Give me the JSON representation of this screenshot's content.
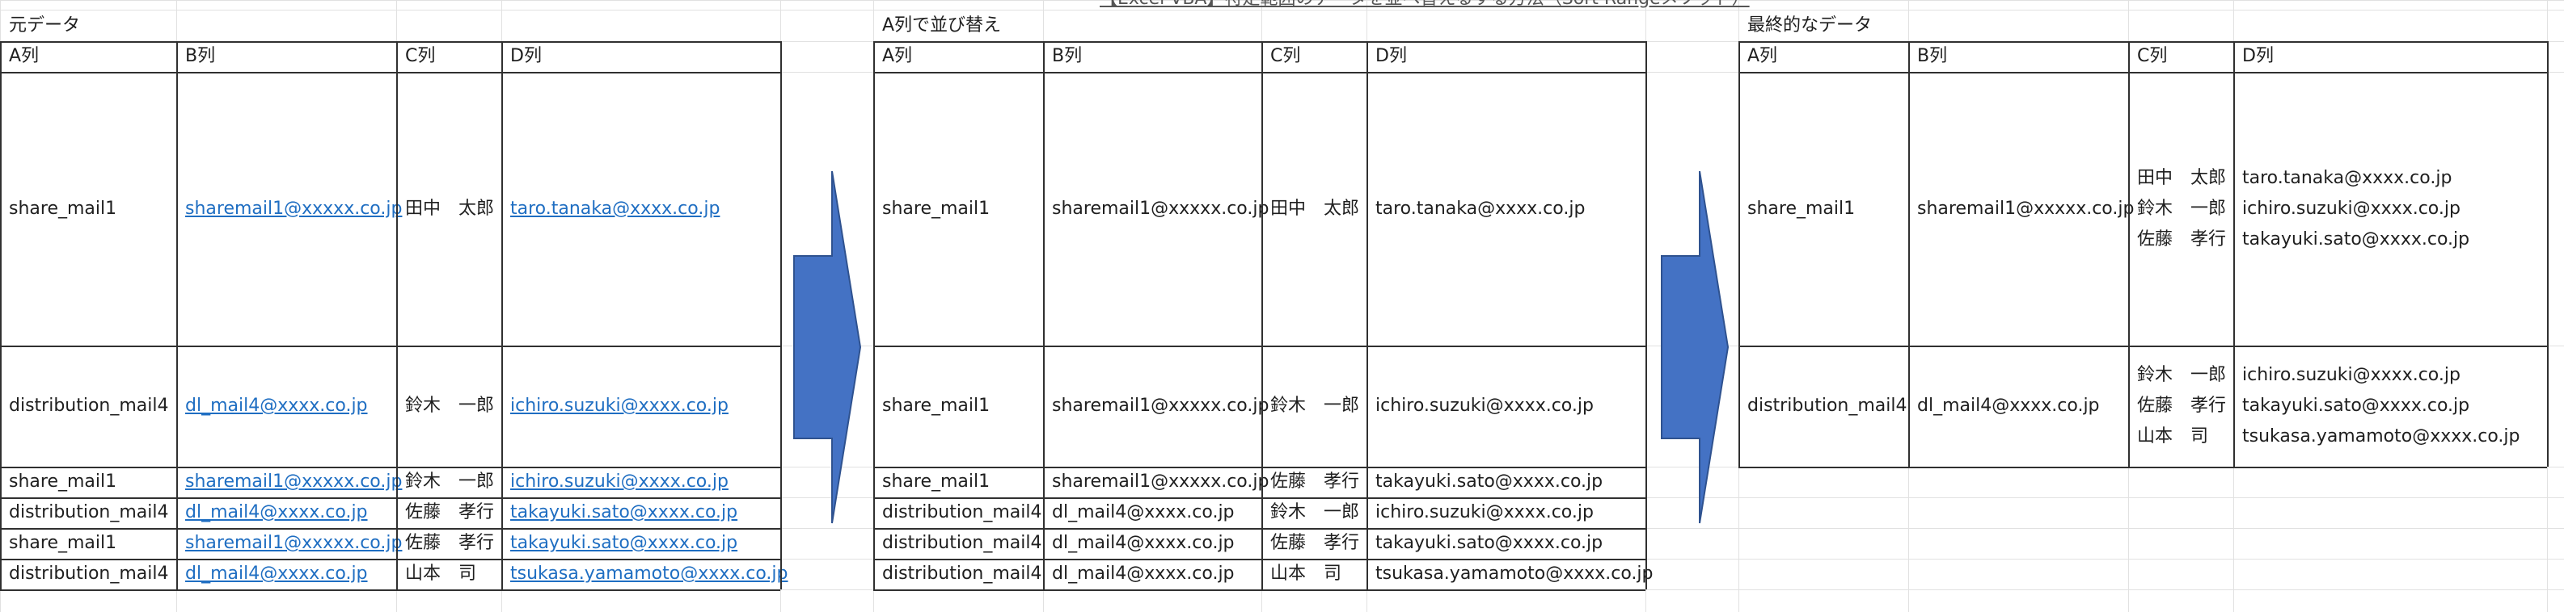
{
  "top_fragments": {
    "link_text": "【Excel VBA】特定範囲のデータを並べ替えるする方法（Sort Rangeメソッド）"
  },
  "tables": [
    {
      "title": "元データ",
      "headers": [
        "A列",
        "B列",
        "C列",
        "D列"
      ],
      "rows": [
        [
          "share_mail1",
          "sharemail1@xxxxx.co.jp",
          "田中　太郎",
          "taro.tanaka@xxxx.co.jp"
        ],
        [
          "distribution_mail4",
          "dl_mail4@xxxx.co.jp",
          "鈴木　一郎",
          "ichiro.suzuki@xxxx.co.jp"
        ],
        [
          "share_mail1",
          "sharemail1@xxxxx.co.jp",
          "鈴木　一郎",
          "ichiro.suzuki@xxxx.co.jp"
        ],
        [
          "distribution_mail4",
          "dl_mail4@xxxx.co.jp",
          "佐藤　孝行",
          "takayuki.sato@xxxx.co.jp"
        ],
        [
          "share_mail1",
          "sharemail1@xxxxx.co.jp",
          "佐藤　孝行",
          "takayuki.sato@xxxx.co.jp"
        ],
        [
          "distribution_mail4",
          "dl_mail4@xxxx.co.jp",
          "山本　司",
          "tsukasa.yamamoto@xxxx.co.jp"
        ]
      ]
    },
    {
      "title": "A列で並び替え",
      "headers": [
        "A列",
        "B列",
        "C列",
        "D列"
      ],
      "rows": [
        [
          "share_mail1",
          "sharemail1@xxxxx.co.jp",
          "田中　太郎",
          "taro.tanaka@xxxx.co.jp"
        ],
        [
          "share_mail1",
          "sharemail1@xxxxx.co.jp",
          "鈴木　一郎",
          "ichiro.suzuki@xxxx.co.jp"
        ],
        [
          "share_mail1",
          "sharemail1@xxxxx.co.jp",
          "佐藤　孝行",
          "takayuki.sato@xxxx.co.jp"
        ],
        [
          "distribution_mail4",
          "dl_mail4@xxxx.co.jp",
          "鈴木　一郎",
          "ichiro.suzuki@xxxx.co.jp"
        ],
        [
          "distribution_mail4",
          "dl_mail4@xxxx.co.jp",
          "佐藤　孝行",
          "takayuki.sato@xxxx.co.jp"
        ],
        [
          "distribution_mail4",
          "dl_mail4@xxxx.co.jp",
          "山本　司",
          "tsukasa.yamamoto@xxxx.co.jp"
        ]
      ]
    },
    {
      "title": "最終的なデータ",
      "headers": [
        "A列",
        "B列",
        "C列",
        "D列"
      ],
      "rows": [
        {
          "a": "share_mail1",
          "b": "sharemail1@xxxxx.co.jp",
          "c": [
            "田中　太郎",
            "鈴木　一郎",
            "佐藤　孝行"
          ],
          "d": [
            "taro.tanaka@xxxx.co.jp",
            "ichiro.suzuki@xxxx.co.jp",
            "takayuki.sato@xxxx.co.jp"
          ]
        },
        {
          "a": "distribution_mail4",
          "b": "dl_mail4@xxxx.co.jp",
          "c": [
            "鈴木　一郎",
            "佐藤　孝行",
            "山本　司"
          ],
          "d": [
            "ichiro.suzuki@xxxx.co.jp",
            "takayuki.sato@xxxx.co.jp",
            "tsukasa.yamamoto@xxxx.co.jp"
          ]
        }
      ]
    }
  ],
  "colors": {
    "arrow_fill": "#4472c4",
    "arrow_stroke": "#2f528f",
    "link": "#1f6ec2",
    "gridline": "#e1e1e1"
  }
}
